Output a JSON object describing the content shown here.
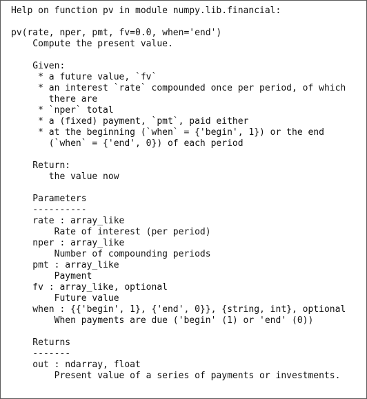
{
  "help": {
    "lines": [
      "Help on function pv in module numpy.lib.financial:",
      "",
      "pv(rate, nper, pmt, fv=0.0, when='end')",
      "    Compute the present value.",
      "",
      "    Given:",
      "     * a future value, `fv`",
      "     * an interest `rate` compounded once per period, of which",
      "       there are",
      "     * `nper` total",
      "     * a (fixed) payment, `pmt`, paid either",
      "     * at the beginning (`when` = {'begin', 1}) or the end",
      "       (`when` = {'end', 0}) of each period",
      "",
      "    Return:",
      "       the value now",
      "",
      "    Parameters",
      "    ----------",
      "    rate : array_like",
      "        Rate of interest (per period)",
      "    nper : array_like",
      "        Number of compounding periods",
      "    pmt : array_like",
      "        Payment",
      "    fv : array_like, optional",
      "        Future value",
      "    when : {{'begin', 1}, {'end', 0}}, {string, int}, optional",
      "        When payments are due ('begin' (1) or 'end' (0))",
      "",
      "    Returns",
      "    -------",
      "    out : ndarray, float",
      "        Present value of a series of payments or investments."
    ]
  }
}
